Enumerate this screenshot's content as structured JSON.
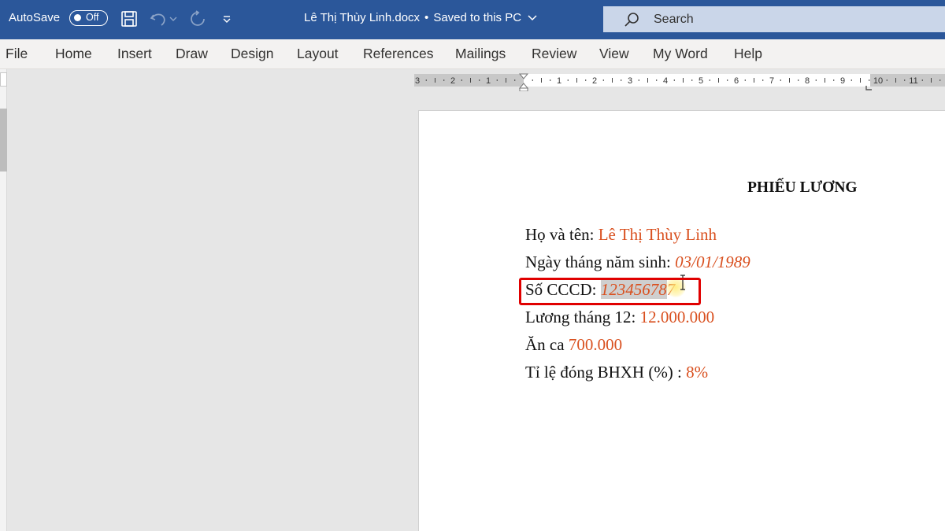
{
  "titlebar": {
    "autosave_label": "AutoSave",
    "autosave_state": "Off",
    "document_title": "Lê Thị Thùy Linh.docx",
    "save_status": "Saved to this PC",
    "search_placeholder": "Search",
    "colors": {
      "bar": "#2b579a",
      "search_bg": "#cad6e9"
    },
    "icons": [
      "save-icon",
      "undo-icon",
      "redo-icon",
      "customize-qat-icon",
      "chevron-down-icon",
      "search-icon"
    ]
  },
  "ribbon": {
    "tabs": [
      "File",
      "Home",
      "Insert",
      "Draw",
      "Design",
      "Layout",
      "References",
      "Mailings",
      "Review",
      "View",
      "My Word",
      "Help"
    ]
  },
  "ruler": {
    "left_labels": [
      "3",
      "2",
      "1"
    ],
    "right_labels": [
      "1",
      "2",
      "3",
      "4",
      "5",
      "6",
      "7",
      "8",
      "9",
      "10",
      "11"
    ]
  },
  "document": {
    "heading": "PHIẾU LƯƠNG",
    "fields": [
      {
        "label": "Họ và tên: ",
        "value": "Lê Thị Thùy Linh"
      },
      {
        "label": "Ngày tháng năm sinh: ",
        "value": "03/01/1989"
      },
      {
        "label": "Số CCCD: ",
        "value": "12345678",
        "value_tail": "7"
      },
      {
        "label": "Lương tháng 12: ",
        "value": "12.000.000"
      },
      {
        "label": "Ăn ca ",
        "value": "700.000"
      },
      {
        "label": "Tỉ lệ đóng BHXH (%) : ",
        "value": "8%"
      }
    ],
    "colors": {
      "value_text": "#d9501f",
      "highlight_box": "#e00000",
      "selection": "#cfcfcf"
    }
  }
}
